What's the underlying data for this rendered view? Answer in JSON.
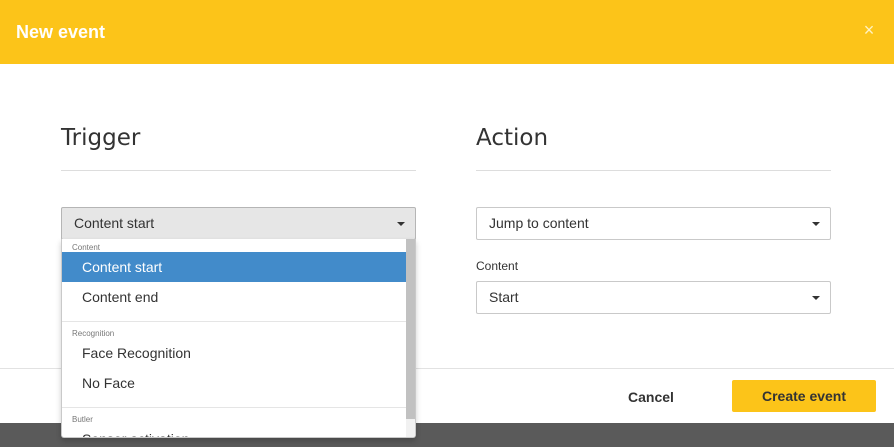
{
  "header": {
    "title": "New event",
    "close_glyph": "×"
  },
  "trigger": {
    "title": "Trigger",
    "selected": "Content start"
  },
  "action": {
    "title": "Action",
    "selected": "Jump to content",
    "content_label": "Content",
    "content_selected": "Start"
  },
  "dropdown": {
    "groups": [
      {
        "label": "Content",
        "options": [
          "Content start",
          "Content end"
        ]
      },
      {
        "label": "Recognition",
        "options": [
          "Face Recognition",
          "No Face"
        ]
      },
      {
        "label": "Butler",
        "options": [
          "Sensor activation"
        ]
      }
    ],
    "selected_option": "Content start"
  },
  "footer": {
    "cancel_label": "Cancel",
    "create_label": "Create event"
  },
  "colors": {
    "accent": "#fcc419",
    "selected_option": "#428bca",
    "backdrop": "#5a5a5a"
  }
}
